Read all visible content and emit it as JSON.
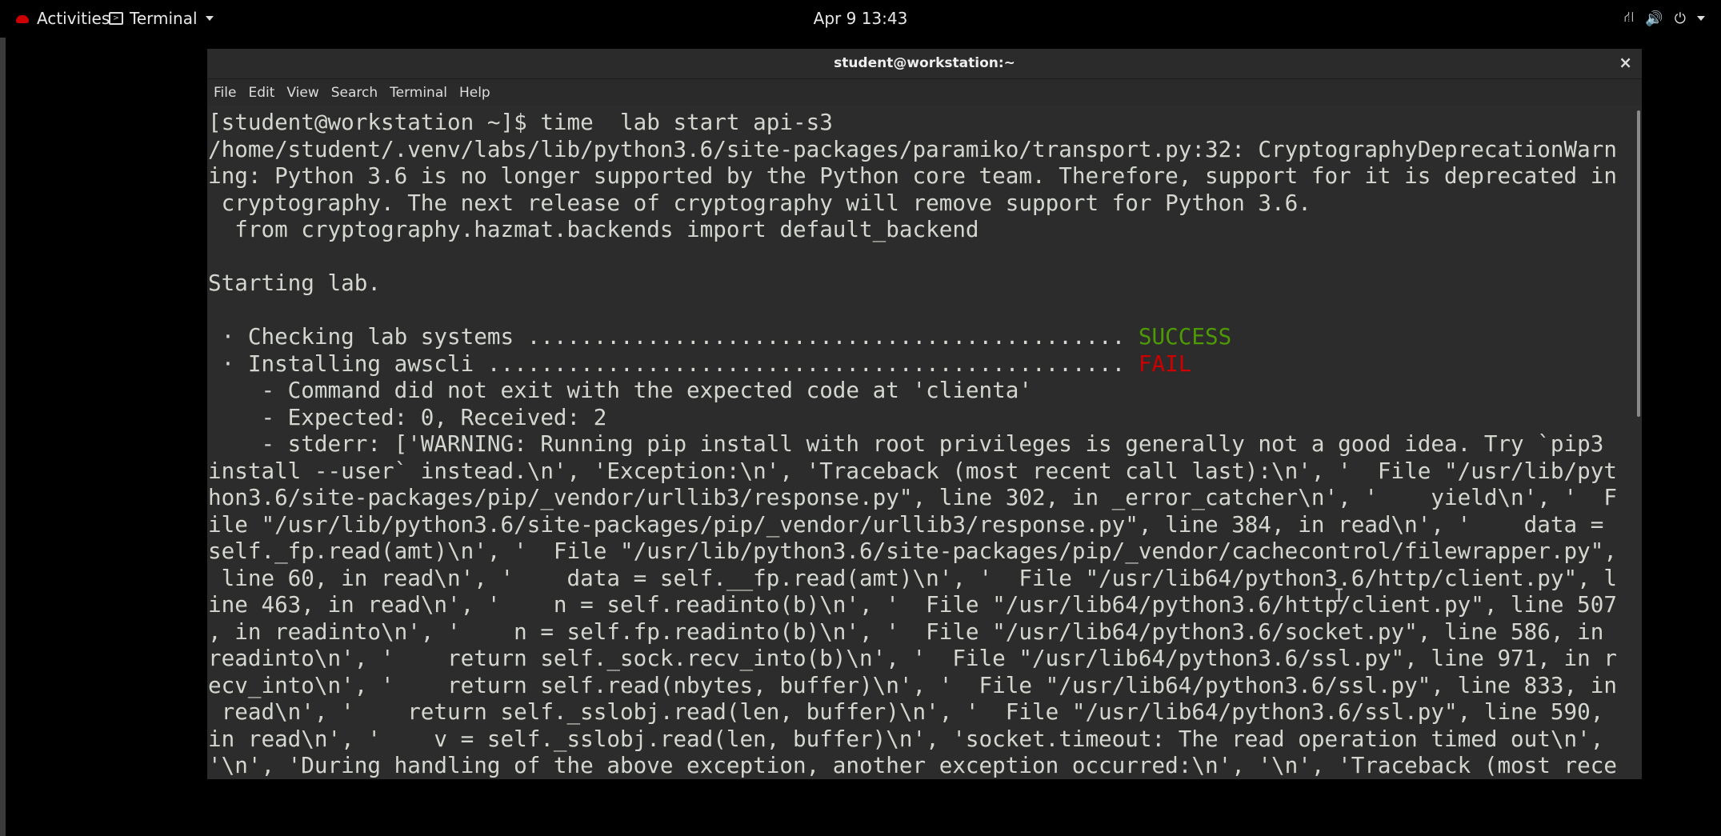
{
  "topbar": {
    "activities": "Activities",
    "app_name": "Terminal",
    "clock": "Apr 9  13:43",
    "icons": [
      "network-icon",
      "volume-icon",
      "power-icon",
      "chevron-down-icon"
    ]
  },
  "window": {
    "title": "student@workstation:~",
    "close": "×"
  },
  "menu": {
    "file": "File",
    "edit": "Edit",
    "view": "View",
    "search": "Search",
    "terminal": "Terminal",
    "help": "Help"
  },
  "colors": {
    "success": "#4e9a06",
    "fail": "#cc0000",
    "text": "#d3d7cf",
    "background": "#2c2c2c"
  },
  "terminal": {
    "lines": [
      "[student@workstation ~]$ time  lab start api-s3",
      "/home/student/.venv/labs/lib/python3.6/site-packages/paramiko/transport.py:32: CryptographyDeprecationWarn",
      "ing: Python 3.6 is no longer supported by the Python core team. Therefore, support for it is deprecated in",
      " cryptography. The next release of cryptography will remove support for Python 3.6.",
      "  from cryptography.hazmat.backends import default_backend",
      "",
      "Starting lab.",
      "",
      " · Checking lab systems ............................................. ",
      " · Installing awscli ................................................ ",
      "    - Command did not exit with the expected code at 'clienta'",
      "    - Expected: 0, Received: 2",
      "    - stderr: ['WARNING: Running pip install with root privileges is generally not a good idea. Try `pip3",
      "install --user` instead.\\n', 'Exception:\\n', 'Traceback (most recent call last):\\n', '  File \"/usr/lib/pyt",
      "hon3.6/site-packages/pip/_vendor/urllib3/response.py\", line 302, in _error_catcher\\n', '    yield\\n', '  F",
      "ile \"/usr/lib/python3.6/site-packages/pip/_vendor/urllib3/response.py\", line 384, in read\\n', '    data =",
      "self._fp.read(amt)\\n', '  File \"/usr/lib/python3.6/site-packages/pip/_vendor/cachecontrol/filewrapper.py\",",
      " line 60, in read\\n', '    data = self.__fp.read(amt)\\n', '  File \"/usr/lib64/python3.6/http/client.py\", l",
      "ine 463, in read\\n', '    n = self.readinto(b)\\n', '  File \"/usr/lib64/python3.6/http/client.py\", line 507",
      ", in readinto\\n', '    n = self.fp.readinto(b)\\n', '  File \"/usr/lib64/python3.6/socket.py\", line 586, in",
      "readinto\\n', '    return self._sock.recv_into(b)\\n', '  File \"/usr/lib64/python3.6/ssl.py\", line 971, in r",
      "ecv_into\\n', '    return self.read(nbytes, buffer)\\n', '  File \"/usr/lib64/python3.6/ssl.py\", line 833, in",
      " read\\n', '    return self._sslobj.read(len, buffer)\\n', '  File \"/usr/lib64/python3.6/ssl.py\", line 590,",
      "in read\\n', '    v = self._sslobj.read(len, buffer)\\n', 'socket.timeout: The read operation timed out\\n',",
      "'\\n', 'During handling of the above exception, another exception occurred:\\n', '\\n', 'Traceback (most rece"
    ],
    "status_success": "SUCCESS",
    "status_fail": "FAIL"
  }
}
